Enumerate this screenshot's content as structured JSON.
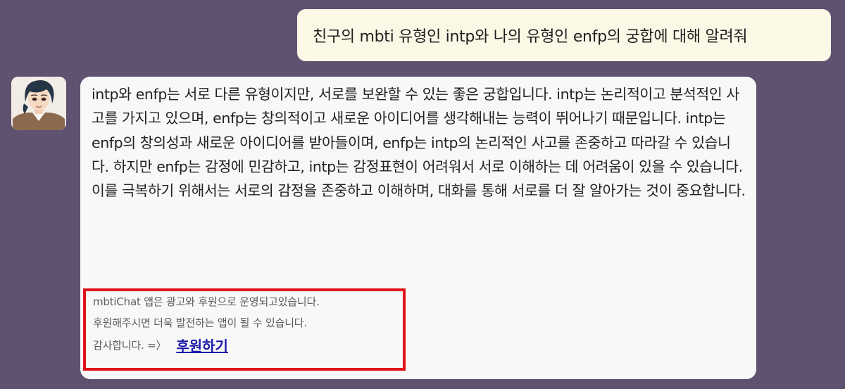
{
  "user_message": {
    "text": "친구의 mbti 유형인 intp와 나의 유형인 enfp의 궁합에 대해 알려줘"
  },
  "assistant": {
    "avatar": "assistant-avatar-illustration",
    "message": "intp와 enfp는 서로 다른 유형이지만, 서로를 보완할 수 있는 좋은 궁합입니다. intp는 논리적이고 분석적인 사고를 가지고 있으며, enfp는 창의적이고 새로운 아이디어를 생각해내는 능력이 뛰어나기 때문입니다. intp는 enfp의 창의성과 새로운 아이디어를 받아들이며, enfp는 intp의 논리적인 사고를 존중하고 따라갈 수 있습니다. 하지만 enfp는 감정에 민감하고, intp는 감정표현이 어려워서 서로 이해하는 데 어려움이 있을 수 있습니다. 이를 극복하기 위해서는 서로의 감정을 존중하고 이해하며, 대화를 통해 서로를 더 잘 알아가는 것이 중요합니다."
  },
  "notice": {
    "line1": "mbtiChat 앱은 광고와 후원으로 운영되고있습니다.",
    "line2": "후원해주시면 더욱 발전하는 앱이 될 수 있습니다.",
    "line3": "감사합니다. =〉",
    "donate_label": "후원하기"
  },
  "colors": {
    "background": "#5f5170",
    "user_bubble": "#fcf8e6",
    "assistant_bubble": "#f8f8f8",
    "notice_border": "#e1141b",
    "link": "#1a1aa8"
  }
}
